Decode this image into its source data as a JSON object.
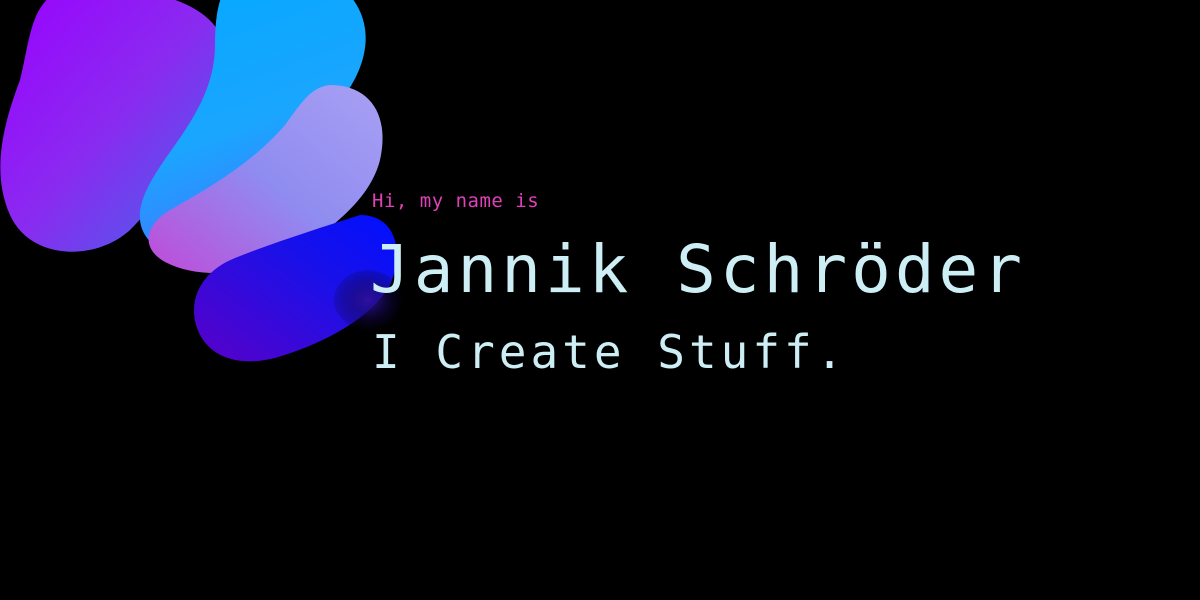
{
  "hero": {
    "intro": "Hi, my name is",
    "name": "Jannik Schröder",
    "tagline": "I Create Stuff."
  },
  "colors": {
    "background": "#000000",
    "intro_text": "#e040b8",
    "main_text": "#cdeef4"
  },
  "graphics": {
    "blob": "abstract-gradient-blob"
  }
}
